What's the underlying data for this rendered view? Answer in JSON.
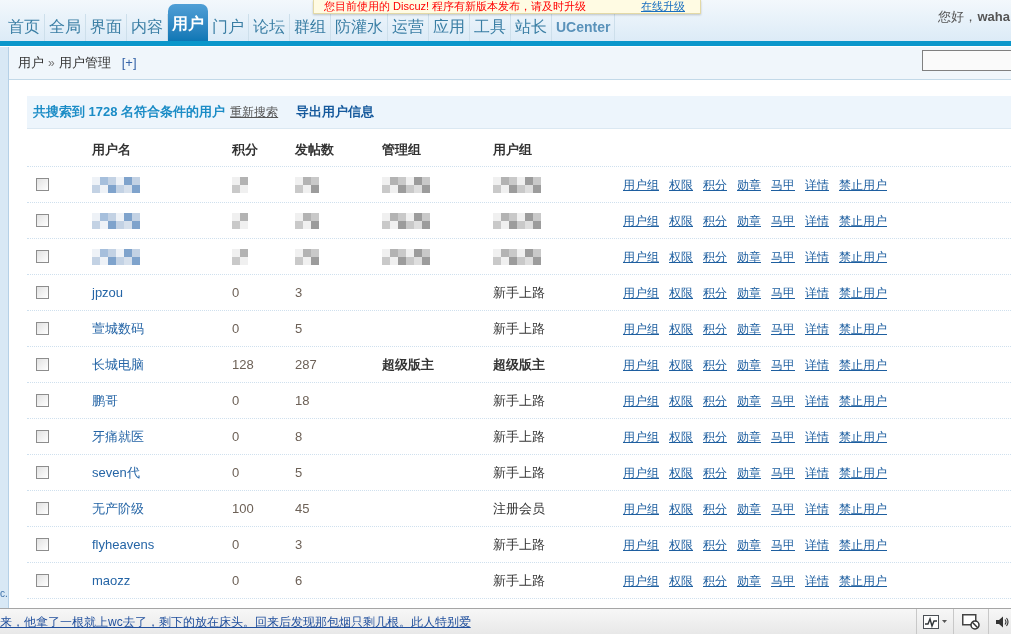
{
  "update_notice": {
    "text": "您目前使用的 Discuz! 程序有新版本发布，请及时升级",
    "link": "在线升级"
  },
  "nav": {
    "tabs": [
      {
        "label": "首页",
        "kind": "section",
        "selected": false
      },
      {
        "label": "全局",
        "kind": "section",
        "selected": false
      },
      {
        "label": "界面",
        "kind": "section",
        "selected": false
      },
      {
        "label": "内容",
        "kind": "section",
        "selected": false
      },
      {
        "label": "用户",
        "kind": "section",
        "selected": true
      },
      {
        "label": "门户",
        "kind": "section",
        "selected": false
      },
      {
        "label": "论坛",
        "kind": "section",
        "selected": false
      },
      {
        "label": "群组",
        "kind": "section",
        "selected": false
      },
      {
        "label": "防灌水",
        "kind": "section",
        "selected": false
      },
      {
        "label": "运营",
        "kind": "section",
        "selected": false
      },
      {
        "label": "应用",
        "kind": "section",
        "selected": false
      },
      {
        "label": "工具",
        "kind": "section",
        "selected": false
      },
      {
        "label": "站长",
        "kind": "section",
        "selected": false
      },
      {
        "label": "UCenter",
        "kind": "app",
        "selected": false
      }
    ]
  },
  "greeting": "您好，**waha**",
  "breadcrumb": {
    "items": [
      "用户",
      "用户管理"
    ],
    "separator": "»",
    "add_link": "[+]"
  },
  "sidebar_fragment": "c.",
  "results": {
    "summary": "共搜索到 1728 名符合条件的用户",
    "research_link": "重新搜索",
    "export_link": "导出用户信息"
  },
  "table": {
    "columns": [
      "用户名",
      "积分",
      "发帖数",
      "管理组",
      "用户组"
    ],
    "rows": [
      {
        "kind": "redacted",
        "checked": false,
        "actions": [
          "用户组",
          "权限",
          "积分",
          "勋章",
          "马甲",
          "详情",
          "禁止用户"
        ]
      },
      {
        "kind": "redacted",
        "checked": false,
        "actions": [
          "用户组",
          "权限",
          "积分",
          "勋章",
          "马甲",
          "详情",
          "禁止用户"
        ]
      },
      {
        "kind": "redacted",
        "checked": false,
        "actions": [
          "用户组",
          "权限",
          "积分",
          "勋章",
          "马甲",
          "详情",
          "禁止用户"
        ]
      },
      {
        "kind": "user",
        "checked": false,
        "username": "jpzou",
        "points": "0",
        "posts": "3",
        "user_group": "新手上路",
        "emphasized": false,
        "actions": [
          "用户组",
          "权限",
          "积分",
          "勋章",
          "马甲",
          "详情",
          "禁止用户"
        ]
      },
      {
        "kind": "user",
        "checked": false,
        "username": "萱城数码",
        "points": "0",
        "posts": "5",
        "user_group": "新手上路",
        "emphasized": false,
        "actions": [
          "用户组",
          "权限",
          "积分",
          "勋章",
          "马甲",
          "详情",
          "禁止用户"
        ]
      },
      {
        "kind": "user",
        "checked": false,
        "username": "长城电脑",
        "points": "128",
        "posts": "287",
        "admin_group": "超级版主",
        "user_group": "超级版主",
        "emphasized": true,
        "actions": [
          "用户组",
          "权限",
          "积分",
          "勋章",
          "马甲",
          "详情",
          "禁止用户"
        ]
      },
      {
        "kind": "user",
        "checked": false,
        "username": "鹏哥",
        "points": "0",
        "posts": "18",
        "user_group": "新手上路",
        "emphasized": false,
        "actions": [
          "用户组",
          "权限",
          "积分",
          "勋章",
          "马甲",
          "详情",
          "禁止用户"
        ]
      },
      {
        "kind": "user",
        "checked": false,
        "username": "牙痛就医",
        "points": "0",
        "posts": "8",
        "user_group": "新手上路",
        "emphasized": false,
        "actions": [
          "用户组",
          "权限",
          "积分",
          "勋章",
          "马甲",
          "详情",
          "禁止用户"
        ]
      },
      {
        "kind": "user",
        "checked": false,
        "username": "seven代",
        "points": "0",
        "posts": "5",
        "user_group": "新手上路",
        "emphasized": false,
        "actions": [
          "用户组",
          "权限",
          "积分",
          "勋章",
          "马甲",
          "详情",
          "禁止用户"
        ]
      },
      {
        "kind": "user",
        "checked": false,
        "username": "无产阶级",
        "points": "100",
        "posts": "45",
        "user_group": "注册会员",
        "emphasized": false,
        "actions": [
          "用户组",
          "权限",
          "积分",
          "勋章",
          "马甲",
          "详情",
          "禁止用户"
        ]
      },
      {
        "kind": "user",
        "checked": false,
        "username": "flyheavens",
        "points": "0",
        "posts": "3",
        "user_group": "新手上路",
        "emphasized": false,
        "actions": [
          "用户组",
          "权限",
          "积分",
          "勋章",
          "马甲",
          "详情",
          "禁止用户"
        ]
      },
      {
        "kind": "user",
        "checked": false,
        "username": "maozz",
        "points": "0",
        "posts": "6",
        "user_group": "新手上路",
        "emphasized": false,
        "actions": [
          "用户组",
          "权限",
          "积分",
          "勋章",
          "马甲",
          "详情",
          "禁止用户"
        ]
      }
    ]
  },
  "status_bar": {
    "ticker": "来，他拿了一根就上wc去了，剩下的放在床头。回来后发现那包烟只剩几根。此人特别爱"
  }
}
